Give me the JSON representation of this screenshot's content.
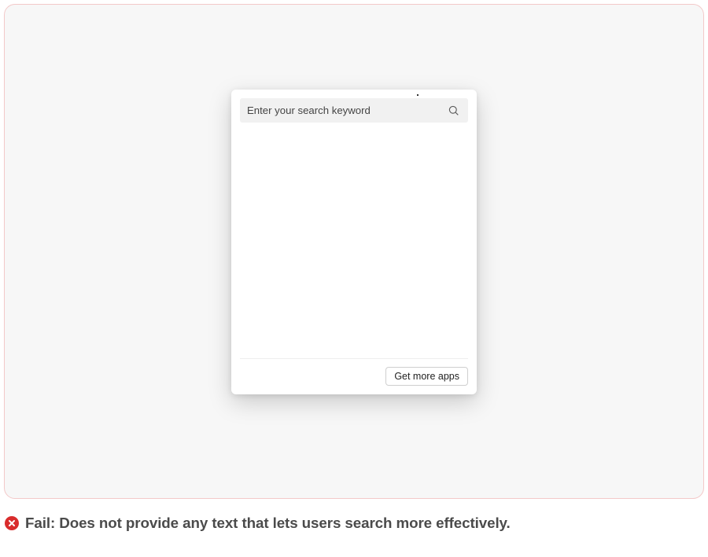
{
  "search": {
    "placeholder": "Enter your search keyword"
  },
  "card": {
    "more_apps_label": "Get more apps"
  },
  "caption": {
    "status_label": "Fail:",
    "message": "Does not provide any text that lets users search more effectively."
  },
  "colors": {
    "fail_icon": "#d92c2c"
  }
}
